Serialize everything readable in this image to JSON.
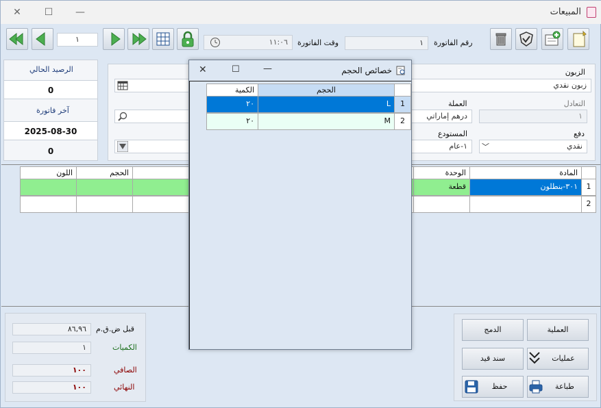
{
  "window": {
    "title": "المبيعات"
  },
  "toolbar": {
    "record_number": "١",
    "invoice_time_label": "وقت الفاتورة",
    "invoice_time": "١١:٠٦",
    "invoice_number_label": "رقم الفاتورة",
    "invoice_number": "١"
  },
  "balance": {
    "current_balance_label": "الرصيد الحالي",
    "current_balance": "0",
    "last_invoice_label": "آخر فاتورة",
    "last_invoice_date": "2025-08-30",
    "last_invoice_value": "0"
  },
  "form": {
    "customer_label": "الزبون",
    "customer_value": "زبون نقدي",
    "exchange_label": "التعادل",
    "exchange_value": "١",
    "currency_label": "العملة",
    "currency_value": "درهم إماراتي",
    "payment_label": "دفع",
    "payment_value": "نقدي",
    "warehouse_label": "المستودع",
    "warehouse_value": "١-عام"
  },
  "items_grid": {
    "headers": {
      "item": "المادة",
      "unit": "الوحدة",
      "size": "الحجم",
      "color": "اللون"
    },
    "rows": [
      {
        "item": "٣٠١-بنطلون",
        "unit": "قطعة",
        "size": "",
        "color": "",
        "index": "1"
      },
      {
        "item": "",
        "unit": "",
        "size": "",
        "color": "",
        "index": "2"
      }
    ]
  },
  "totals": {
    "before_tax_label": "قبل ض.ق.م",
    "before_tax_value": "٨٦,٩٦",
    "quantities_label": "الكميات",
    "quantities_value": "١",
    "net_label": "الصافي",
    "net_value": "١٠٠",
    "final_label": "النهائي",
    "final_value": "١٠٠"
  },
  "actions": {
    "operation": "العملية",
    "merge": "الدمج",
    "operations": "عمليات",
    "entry_voucher": "سند قيد",
    "print": "طباعة",
    "save": "حفظ"
  },
  "size_dialog": {
    "title": "خصائص الحجم",
    "headers": {
      "size": "الحجم",
      "quantity": "الكمية"
    },
    "rows": [
      {
        "index": "1",
        "size": "L",
        "quantity": "٢٠"
      },
      {
        "index": "2",
        "size": "M",
        "quantity": "٢٠"
      }
    ]
  },
  "colors": {
    "selection_blue": "#0078d7",
    "row_green": "#90ee90",
    "dark_red_value": "#8b0000",
    "label_blue": "#1f3d7a",
    "label_green": "#1a6e1a"
  }
}
